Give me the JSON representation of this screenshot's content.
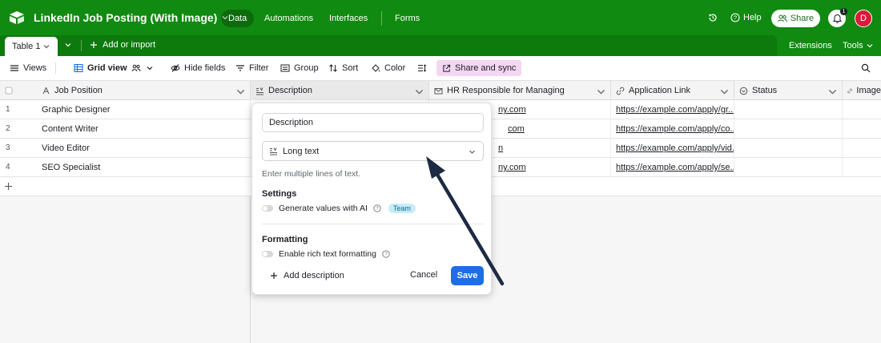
{
  "header": {
    "base_title": "LinkedIn Job Posting (With Image)",
    "nav": [
      "Data",
      "Automations",
      "Interfaces",
      "Forms"
    ],
    "help_label": "Help",
    "share_label": "Share",
    "notifications_count": "1",
    "avatar_initial": "D"
  },
  "tabbar": {
    "table_tab": "Table 1",
    "add_import": "Add or import",
    "extensions": "Extensions",
    "tools": "Tools"
  },
  "toolbar": {
    "views": "Views",
    "grid_view": "Grid view",
    "hide_fields": "Hide fields",
    "filter": "Filter",
    "group": "Group",
    "sort": "Sort",
    "color": "Color",
    "share_sync": "Share and sync"
  },
  "grid": {
    "columns": [
      "Job Position",
      "Description",
      "HR Responsible for Managing",
      "Application Link",
      "Status",
      "Image"
    ],
    "rows": [
      {
        "num": "1",
        "position": "Graphic Designer",
        "hr": "ny.com",
        "link": "https://example.com/apply/gr..."
      },
      {
        "num": "2",
        "position": "Content Writer",
        "hr": "com",
        "link": "https://example.com/apply/co..."
      },
      {
        "num": "3",
        "position": "Video Editor",
        "hr": "n",
        "link": "https://example.com/apply/vid..."
      },
      {
        "num": "4",
        "position": "SEO Specialist",
        "hr": "ny.com",
        "link": "https://example.com/apply/se..."
      }
    ]
  },
  "popover": {
    "field_name": "Description",
    "field_type": "Long text",
    "type_help": "Enter multiple lines of text.",
    "settings_heading": "Settings",
    "ai_toggle_label": "Generate values with AI",
    "team_badge": "Team",
    "formatting_heading": "Formatting",
    "rich_text_label": "Enable rich text formatting",
    "add_description": "Add description",
    "cancel": "Cancel",
    "save": "Save"
  },
  "colors": {
    "topbar": "#118a11",
    "save_button": "#1d6ee5",
    "share_sync_bg": "#f4d6f2",
    "avatar": "#d71b3a"
  }
}
